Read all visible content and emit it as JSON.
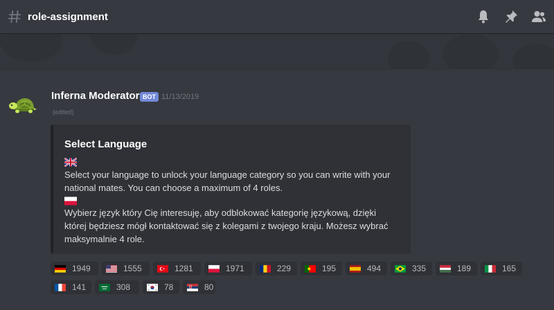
{
  "header": {
    "channel_name": "role-assignment",
    "icons": [
      "bell-icon",
      "pin-icon",
      "members-icon"
    ]
  },
  "message": {
    "author": "Inferna Moderator",
    "bot_tag": "BOT",
    "timestamp": "11/13/2019",
    "edited": "(edited)",
    "embed": {
      "title": "Select Language",
      "english_flag": "uk-flag",
      "english_text": "Select your language to unlock your language category so you can write with your national mates. You can choose a maximum of 4 roles.",
      "polish_flag": "poland-flag",
      "polish_text": "Wybierz język który Cię interesuję, aby odblokować kategorię językową, dzięki której będziesz mógł kontaktować się z kolegami z twojego kraju. Możesz wybrać maksymalnie 4 role."
    }
  },
  "reactions": [
    {
      "flag": "germany",
      "count": "1949"
    },
    {
      "flag": "usa",
      "count": "1555"
    },
    {
      "flag": "turkey",
      "count": "1281"
    },
    {
      "flag": "poland",
      "count": "1971"
    },
    {
      "flag": "romania",
      "count": "229"
    },
    {
      "flag": "portugal",
      "count": "195"
    },
    {
      "flag": "spain",
      "count": "494"
    },
    {
      "flag": "brazil",
      "count": "335"
    },
    {
      "flag": "hungary",
      "count": "189"
    },
    {
      "flag": "italy",
      "count": "165"
    },
    {
      "flag": "france",
      "count": "141"
    },
    {
      "flag": "saudi-arabia",
      "count": "308"
    },
    {
      "flag": "south-korea",
      "count": "78"
    },
    {
      "flag": "serbia",
      "count": "80"
    }
  ],
  "colors": {
    "background": "#36393f",
    "embed": "#2f3136",
    "bot_tag": "#7289da",
    "muted_text": "#72767d"
  }
}
